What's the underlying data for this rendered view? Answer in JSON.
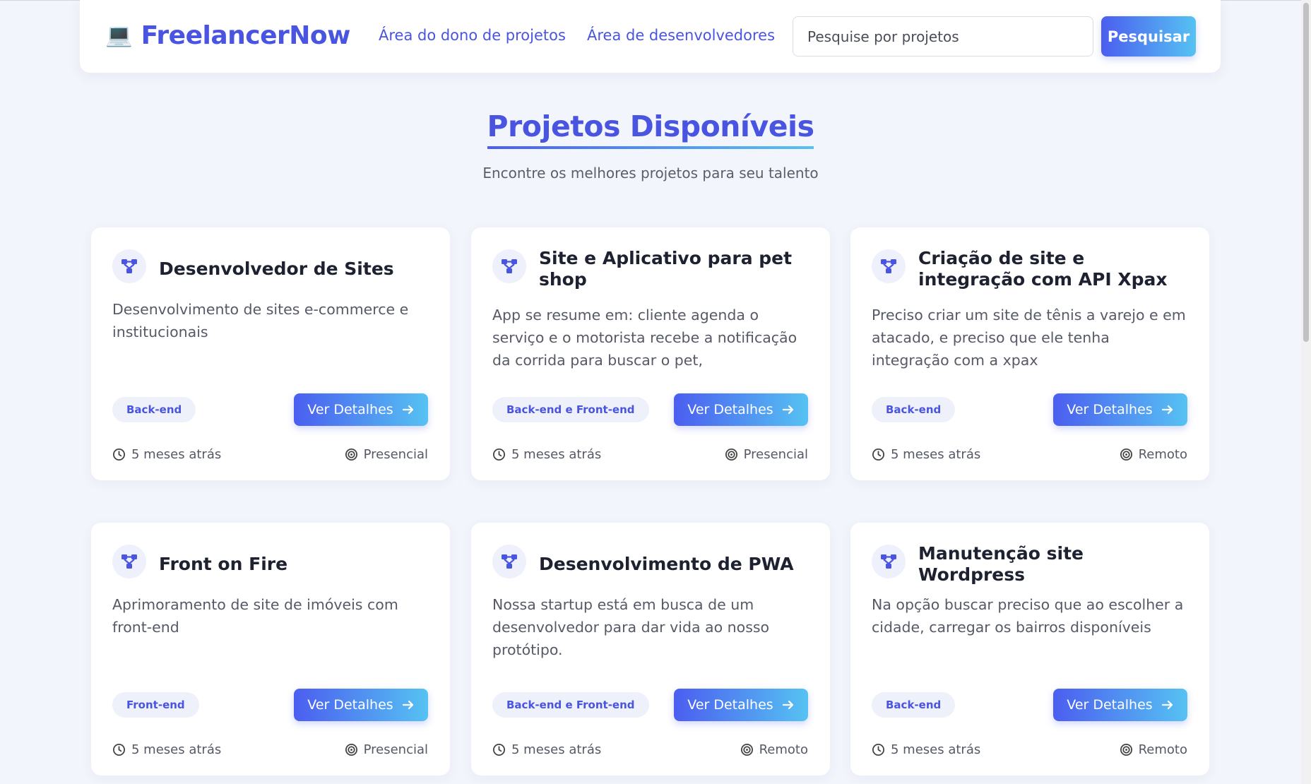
{
  "header": {
    "brand_icon": "💻",
    "brand_name": "FreelancerNow",
    "nav": {
      "owner_area": "Área do dono de projetos",
      "developer_area": "Área de desenvolvedores"
    },
    "search": {
      "placeholder": "Pesquise por projetos",
      "value": "",
      "button_label": "Pesquisar"
    }
  },
  "section": {
    "title": "Projetos Disponíveis",
    "subtitle": "Encontre os melhores projetos para seu talento"
  },
  "icons": {
    "card_icon": "project-network-icon",
    "time_icon": "clock-icon",
    "mode_icon": "target-icon",
    "button_arrow": "arrow-right-icon"
  },
  "colors": {
    "accent": "#4955e0",
    "gradient_start": "#4b5ef0",
    "gradient_end": "#56c2f2",
    "background": "#f3f5fc"
  },
  "cards": [
    {
      "title": "Desenvolvedor de Sites",
      "description": "Desenvolvimento de sites e-commerce e institucionais",
      "tag": "Back-end",
      "button_label": "Ver Detalhes",
      "time": "5 meses atrás",
      "mode": "Presencial"
    },
    {
      "title": "Site e Aplicativo para pet shop",
      "description": "App se resume em: cliente agenda o serviço e o motorista recebe a notificação da corrida para buscar o pet,",
      "tag": "Back-end e Front-end",
      "button_label": "Ver Detalhes",
      "time": "5 meses atrás",
      "mode": "Presencial"
    },
    {
      "title": "Criação de site e integração com API Xpax",
      "description": "Preciso criar um site de tênis a varejo e em atacado, e preciso que ele tenha integração com a xpax",
      "tag": "Back-end",
      "button_label": "Ver Detalhes",
      "time": "5 meses atrás",
      "mode": "Remoto"
    },
    {
      "title": "Front on Fire",
      "description": "Aprimoramento de site de imóveis com front-end",
      "tag": "Front-end",
      "button_label": "Ver Detalhes",
      "time": "5 meses atrás",
      "mode": "Presencial"
    },
    {
      "title": "Desenvolvimento de PWA",
      "description": "Nossa startup está em busca de um desenvolvedor para dar vida ao nosso protótipo.",
      "tag": "Back-end e Front-end",
      "button_label": "Ver Detalhes",
      "time": "5 meses atrás",
      "mode": "Remoto"
    },
    {
      "title": "Manutenção site Wordpress",
      "description": "Na opção buscar preciso que ao escolher a cidade, carregar os bairros disponíveis",
      "tag": "Back-end",
      "button_label": "Ver Detalhes",
      "time": "5 meses atrás",
      "mode": "Remoto"
    }
  ]
}
